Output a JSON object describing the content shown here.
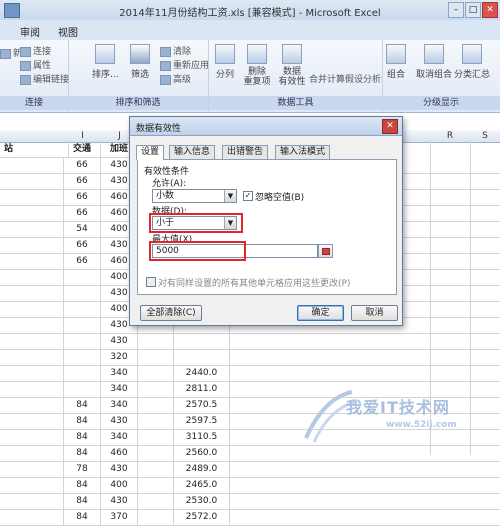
{
  "titlebar": {
    "title": "2014年11月份结构工资.xls [兼容模式] - Microsoft Excel"
  },
  "tabs": {
    "review": "审阅",
    "view": "视图"
  },
  "ribbon": {
    "conn": {
      "item1": "连接",
      "item2": "属性",
      "item3": "编辑链接",
      "left_cut": "新",
      "label": "连接"
    },
    "sort": {
      "sort_label": "排序...",
      "filter_label": "筛选",
      "clear": "清除",
      "reapply": "重新应用",
      "advanced": "高级",
      "label": "排序和筛选"
    },
    "tools": {
      "split": "分列",
      "remove_dup": "删除\n重复项",
      "validation": "数据\n有效性",
      "consolidate": "合并计算",
      "whatif": "假设分析",
      "label": "数据工具"
    },
    "outline": {
      "group": "组合",
      "ungroup": "取消组合",
      "subtotal": "分类汇总",
      "label": "分级显示"
    }
  },
  "columns": {
    "H": "",
    "I": "I",
    "J": "J",
    "K": "K",
    "R": "R",
    "S": "S"
  },
  "sheet": {
    "h_header": "站",
    "i_header": "交通",
    "j_header": "加班",
    "k_header": "其它",
    "rows": [
      {
        "i": "66",
        "j": "430",
        "l": ""
      },
      {
        "i": "66",
        "j": "430",
        "l": ""
      },
      {
        "i": "66",
        "j": "460",
        "l": ""
      },
      {
        "i": "66",
        "j": "460",
        "l": ""
      },
      {
        "i": "54",
        "j": "400",
        "l": ""
      },
      {
        "i": "66",
        "j": "430",
        "l": ""
      },
      {
        "i": "66",
        "j": "460",
        "l": ""
      },
      {
        "i": "",
        "j": "400",
        "l": ""
      },
      {
        "i": "",
        "j": "430",
        "l": ""
      },
      {
        "i": "",
        "j": "400",
        "l": ""
      },
      {
        "i": "",
        "j": "430",
        "l": ""
      },
      {
        "i": "",
        "j": "430",
        "l": ""
      },
      {
        "i": "",
        "j": "320",
        "l": ""
      },
      {
        "i": "",
        "j": "340",
        "l": "2440.0"
      },
      {
        "i": "",
        "j": "340",
        "l": "2811.0"
      },
      {
        "i": "84",
        "j": "340",
        "l": "2570.5"
      },
      {
        "i": "84",
        "j": "430",
        "l": "2597.5"
      },
      {
        "i": "84",
        "j": "340",
        "l": "3110.5"
      },
      {
        "i": "84",
        "j": "460",
        "l": "2560.0"
      },
      {
        "i": "78",
        "j": "430",
        "l": "2489.0"
      },
      {
        "i": "84",
        "j": "400",
        "l": "2465.0"
      },
      {
        "i": "84",
        "j": "430",
        "l": "2530.0"
      },
      {
        "i": "84",
        "j": "370",
        "l": "2572.0"
      }
    ]
  },
  "dialog": {
    "title": "数据有效性",
    "close_glyph": "✕",
    "tabs": [
      "设置",
      "输入信息",
      "出错警告",
      "输入法模式"
    ],
    "group_label": "有效性条件",
    "allow_label": "允许(A):",
    "allow_value": "小数",
    "ignore_blank": "忽略空值(B)",
    "data_label": "数据(D):",
    "data_value": "小于",
    "max_label": "最大值(X)",
    "max_value": "5000",
    "apply_all": "对有同样设置的所有其他单元格应用这些更改(P)",
    "clear_all": "全部清除(C)",
    "ok": "确定",
    "cancel": "取消"
  },
  "watermark": {
    "text": "我爱IT技术网",
    "url": "www.52ij.com"
  }
}
